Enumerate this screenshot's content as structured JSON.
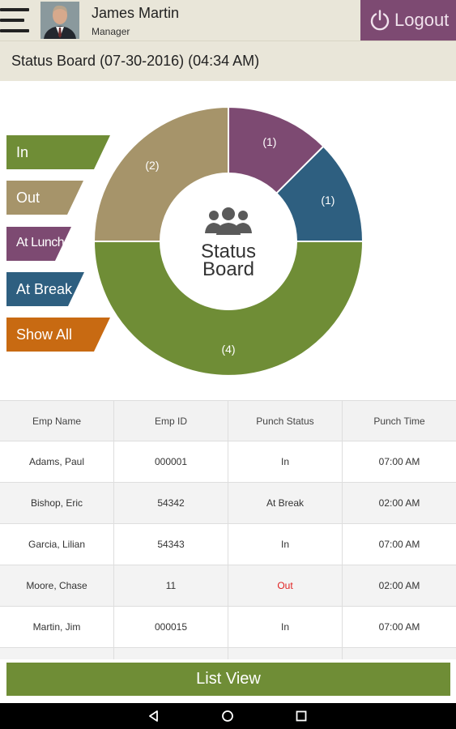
{
  "header": {
    "user_name": "James Martin",
    "user_role": "Manager",
    "logout_label": "Logout"
  },
  "title": "Status Board (07-30-2016) (04:34 AM)",
  "filters": [
    {
      "label": "In",
      "color": "#6f8d36"
    },
    {
      "label": "Out",
      "color": "#a6946a"
    },
    {
      "label": "At Lunch",
      "color": "#7d4a72"
    },
    {
      "label": "At Break",
      "color": "#2e5f80"
    },
    {
      "label": "Show All",
      "color": "#c86a12"
    }
  ],
  "donut": {
    "center_line1": "Status",
    "center_line2": "Board",
    "center_icon": "group-icon",
    "segments": [
      {
        "status": "At Lunch",
        "count": 1,
        "label": "(1)",
        "color": "#7d4a72"
      },
      {
        "status": "At Break",
        "count": 1,
        "label": "(1)",
        "color": "#2e5f80"
      },
      {
        "status": "In",
        "count": 4,
        "label": "(4)",
        "color": "#6f8d36"
      },
      {
        "status": "Out",
        "count": 2,
        "label": "(2)",
        "color": "#a6946a"
      }
    ]
  },
  "table": {
    "headers": [
      "Emp Name",
      "Emp ID",
      "Punch Status",
      "Punch Time"
    ],
    "rows": [
      [
        "Adams, Paul",
        "000001",
        "In",
        "07:00 AM"
      ],
      [
        "Bishop, Eric",
        "54342",
        "At Break",
        "02:00 AM"
      ],
      [
        "Garcia, Lilian",
        "54343",
        "In",
        "07:00 AM"
      ],
      [
        "Moore, Chase",
        "11",
        "Out",
        "02:00 AM"
      ],
      [
        "Martin, Jim",
        "000015",
        "In",
        "07:00 AM"
      ]
    ]
  },
  "list_view_label": "List View",
  "nav": {
    "back_icon": "back-icon",
    "home_icon": "home-icon",
    "recents_icon": "recents-icon"
  }
}
